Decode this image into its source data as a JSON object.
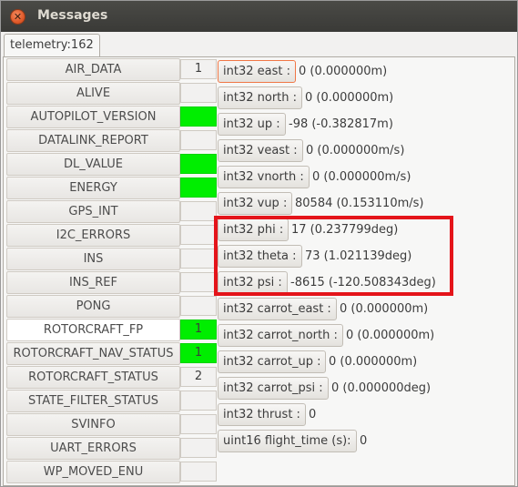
{
  "window": {
    "title": "Messages",
    "close_symbol": "✕"
  },
  "tab": {
    "label": "telemetry:162"
  },
  "messages": [
    {
      "name": "AIR_DATA",
      "count": "1",
      "status": "count"
    },
    {
      "name": "ALIVE",
      "count": "",
      "status": "empty"
    },
    {
      "name": "AUTOPILOT_VERSION",
      "count": "",
      "status": "green"
    },
    {
      "name": "DATALINK_REPORT",
      "count": "",
      "status": "empty"
    },
    {
      "name": "DL_VALUE",
      "count": "",
      "status": "green"
    },
    {
      "name": "ENERGY",
      "count": "",
      "status": "green"
    },
    {
      "name": "GPS_INT",
      "count": "",
      "status": "empty"
    },
    {
      "name": "I2C_ERRORS",
      "count": "",
      "status": "empty"
    },
    {
      "name": "INS",
      "count": "",
      "status": "empty"
    },
    {
      "name": "INS_REF",
      "count": "",
      "status": "empty"
    },
    {
      "name": "PONG",
      "count": "",
      "status": "empty"
    },
    {
      "name": "ROTORCRAFT_FP",
      "count": "1",
      "status": "green"
    },
    {
      "name": "ROTORCRAFT_NAV_STATUS",
      "count": "1",
      "status": "green"
    },
    {
      "name": "ROTORCRAFT_STATUS",
      "count": "2",
      "status": "count"
    },
    {
      "name": "STATE_FILTER_STATUS",
      "count": "",
      "status": "empty"
    },
    {
      "name": "SVINFO",
      "count": "",
      "status": "empty"
    },
    {
      "name": "UART_ERRORS",
      "count": "",
      "status": "empty"
    },
    {
      "name": "WP_MOVED_ENU",
      "count": "",
      "status": "empty"
    }
  ],
  "fields": [
    {
      "label": "int32 east :",
      "value": "0 (0.000000m)"
    },
    {
      "label": "int32 north :",
      "value": "0 (0.000000m)"
    },
    {
      "label": "int32 up :",
      "value": "-98 (-0.382817m)"
    },
    {
      "label": "int32 veast :",
      "value": "0 (0.000000m/s)"
    },
    {
      "label": "int32 vnorth :",
      "value": "0 (0.000000m/s)"
    },
    {
      "label": "int32 vup :",
      "value": "80584 (0.153110m/s)"
    },
    {
      "label": "int32 phi :",
      "value": "17 (0.237799deg)"
    },
    {
      "label": "int32 theta :",
      "value": "73 (1.021139deg)"
    },
    {
      "label": "int32 psi :",
      "value": "-8615 (-120.508343deg)"
    },
    {
      "label": "int32 carrot_east :",
      "value": "0 (0.000000m)"
    },
    {
      "label": "int32 carrot_north :",
      "value": "0 (0.000000m)"
    },
    {
      "label": "int32 carrot_up :",
      "value": "0 (0.000000m)"
    },
    {
      "label": "int32 carrot_psi :",
      "value": "0 (0.000000deg)"
    },
    {
      "label": "int32 thrust :",
      "value": "0"
    },
    {
      "label": "uint16 flight_time (s):",
      "value": "0"
    }
  ],
  "colors": {
    "status_green": "#00ee00",
    "highlight": "#e4141a",
    "focus": "#f07746"
  }
}
